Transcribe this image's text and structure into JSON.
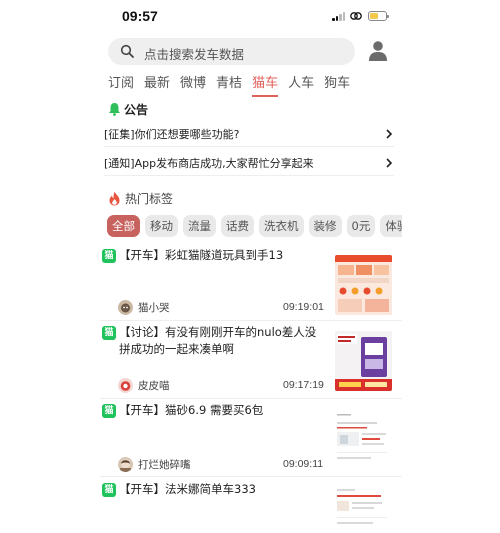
{
  "status_bar": {
    "time": "09:57"
  },
  "search": {
    "placeholder": "点击搜索发车数据"
  },
  "tabs": [
    {
      "label": "订阅"
    },
    {
      "label": "最新"
    },
    {
      "label": "微博"
    },
    {
      "label": "青桔"
    },
    {
      "label": "猫车",
      "active": true
    },
    {
      "label": "人车"
    },
    {
      "label": "狗车"
    }
  ],
  "notice": {
    "title": "公告",
    "items": [
      {
        "text": "[征集]你们还想要哪些功能?"
      },
      {
        "text": "[通知]App发布商店成功,大家帮忙分享起来"
      }
    ]
  },
  "hot_tags": {
    "title": "热门标签",
    "chips": [
      "全部",
      "移动",
      "流量",
      "话费",
      "洗衣机",
      "装修",
      "0元",
      "体验"
    ]
  },
  "posts": [
    {
      "badge": "猫",
      "title": "【开车】彩虹猫隧道玩具到手13",
      "user": "猫小哭",
      "time": "09:19:01"
    },
    {
      "badge": "猫",
      "title": "【讨论】有没有刚刚开车的nulo差人没拼成功的一起来凑单啊",
      "user": "皮皮喵",
      "time": "09:17:19"
    },
    {
      "badge": "猫",
      "title": "【开车】猫砂6.9 需要买6包",
      "user": "打烂她碎嘴",
      "time": "09:09:11"
    },
    {
      "badge": "猫",
      "title": "【开车】法米娜简单车333",
      "user": "",
      "time": ""
    }
  ],
  "colors": {
    "accent": "#e0605a",
    "chip_active": "#c7625e",
    "badge": "#1fc25b"
  }
}
